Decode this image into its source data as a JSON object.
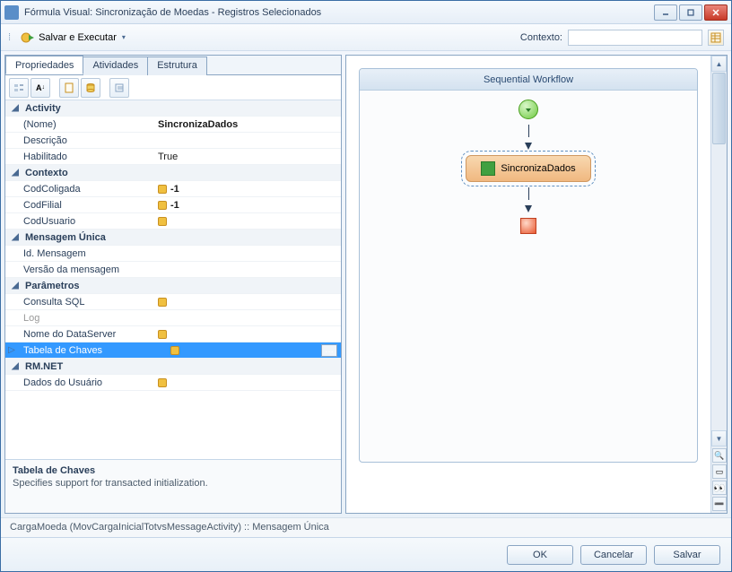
{
  "window": {
    "title": "Fórmula Visual: Sincronização de Moedas - Registros Selecionados"
  },
  "toolbar": {
    "save_execute": "Salvar e Executar",
    "context_label": "Contexto:"
  },
  "tabs": {
    "properties": "Propriedades",
    "activities": "Atividades",
    "structure": "Estrutura"
  },
  "prop_grid": {
    "cat_activity": "Activity",
    "name_key": "(Nome)",
    "name_val": "SincronizaDados",
    "desc_key": "Descrição",
    "desc_val": "",
    "enabled_key": "Habilitado",
    "enabled_val": "True",
    "cat_context": "Contexto",
    "codcoligada_key": "CodColigada",
    "codcoligada_val": "-1",
    "codfilial_key": "CodFilial",
    "codfilial_val": "-1",
    "codusuario_key": "CodUsuario",
    "codusuario_val": "",
    "cat_msg": "Mensagem Única",
    "idmsg_key": "Id. Mensagem",
    "idmsg_val": "",
    "vermsg_key": "Versão da mensagem",
    "vermsg_val": "",
    "cat_params": "Parâmetros",
    "consulta_key": "Consulta SQL",
    "consulta_val": "",
    "log_key": "Log",
    "log_val": "",
    "dataserver_key": "Nome do DataServer",
    "dataserver_val": "",
    "tabela_key": "Tabela de Chaves",
    "tabela_val": "",
    "cat_rmnet": "RM.NET",
    "dadosusuario_key": "Dados do Usuário",
    "dadosusuario_val": ""
  },
  "prop_desc": {
    "title": "Tabela de Chaves",
    "text": "Specifies support for transacted initialization."
  },
  "workflow": {
    "title": "Sequential Workflow",
    "node_label": "SincronizaDados"
  },
  "breadcrumb": "CargaMoeda  (MovCargaInicialTotvsMessageActivity)  ::  Mensagem Única",
  "footer": {
    "ok": "OK",
    "cancel": "Cancelar",
    "save": "Salvar"
  }
}
